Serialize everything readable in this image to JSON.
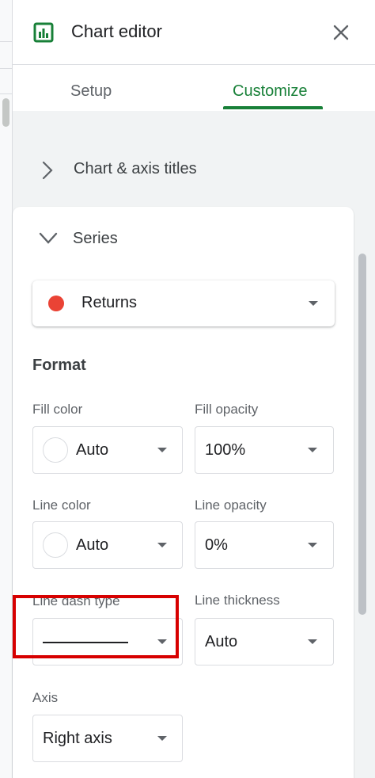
{
  "header": {
    "title": "Chart editor",
    "app_icon": "chart-icon",
    "close_icon": "close-icon"
  },
  "tabs": [
    {
      "label": "Setup",
      "active": false
    },
    {
      "label": "Customize",
      "active": true
    }
  ],
  "sections": {
    "chart_axis_titles": {
      "label": "Chart & axis titles",
      "expanded": false
    },
    "series": {
      "label": "Series",
      "expanded": true,
      "selected_series": {
        "label": "Returns",
        "color": "#ea4335"
      },
      "format": {
        "title": "Format",
        "fill_color": {
          "label": "Fill color",
          "value": "Auto"
        },
        "fill_opacity": {
          "label": "Fill opacity",
          "value": "100%"
        },
        "line_color": {
          "label": "Line color",
          "value": "Auto"
        },
        "line_opacity": {
          "label": "Line opacity",
          "value": "0%"
        },
        "line_dash_type": {
          "label": "Line dash type",
          "value": "solid-line"
        },
        "line_thickness": {
          "label": "Line thickness",
          "value": "Auto"
        }
      },
      "axis": {
        "label": "Axis",
        "value": "Right axis"
      }
    }
  },
  "colors": {
    "accent": "#188038",
    "highlight": "#d70000",
    "series": "#ea4335"
  }
}
